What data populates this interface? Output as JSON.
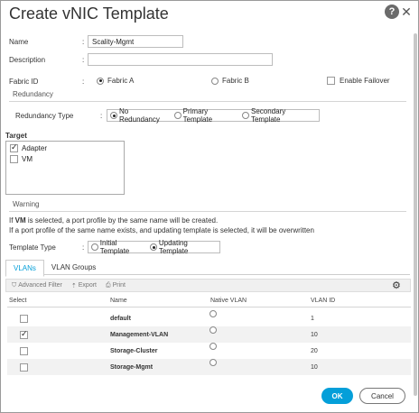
{
  "dialog": {
    "title": "Create vNIC Template",
    "help_icon": "?",
    "close_icon": "✕"
  },
  "form": {
    "name_label": "Name",
    "name_value": "Scality-Mgmt",
    "description_label": "Description",
    "description_value": "",
    "fabric_label": "Fabric ID",
    "fabric_a": "Fabric A",
    "fabric_b": "Fabric B",
    "enable_failover": "Enable Failover",
    "colon": ":"
  },
  "redundancy": {
    "section_title": "Redundancy",
    "type_label": "Redundancy Type",
    "options": [
      "No Redundancy",
      "Primary Template",
      "Secondary Template"
    ],
    "selected_index": 0
  },
  "target": {
    "label": "Target",
    "items": [
      {
        "label": "Adapter",
        "checked": true
      },
      {
        "label": "VM",
        "checked": false
      }
    ]
  },
  "warning": {
    "title": "Warning",
    "line1_prefix": "If ",
    "line1_bold": "VM",
    "line1_suffix": " is selected, a port profile by the same name will be created.",
    "line2": "If a port profile of the same name exists, and updating template is selected, it will be overwritten"
  },
  "template_type": {
    "label": "Template Type",
    "options": [
      "Initial Template",
      "Updating Template"
    ],
    "selected_index": 1
  },
  "tabs": [
    "VLANs",
    "VLAN Groups"
  ],
  "toolbar": {
    "filter": "Advanced Filter",
    "export": "Export",
    "print": "Print"
  },
  "table": {
    "headers": [
      "Select",
      "Name",
      "Native VLAN",
      "VLAN ID"
    ],
    "rows": [
      {
        "name": "default",
        "selected": false,
        "vlan_id": "1"
      },
      {
        "name": "Management-VLAN",
        "selected": true,
        "vlan_id": "10"
      },
      {
        "name": "Storage-Cluster",
        "selected": false,
        "vlan_id": "20"
      },
      {
        "name": "Storage-Mgmt",
        "selected": false,
        "vlan_id": "10"
      }
    ]
  },
  "footer": {
    "ok": "OK",
    "cancel": "Cancel"
  },
  "colors": {
    "accent": "#049fd9"
  }
}
